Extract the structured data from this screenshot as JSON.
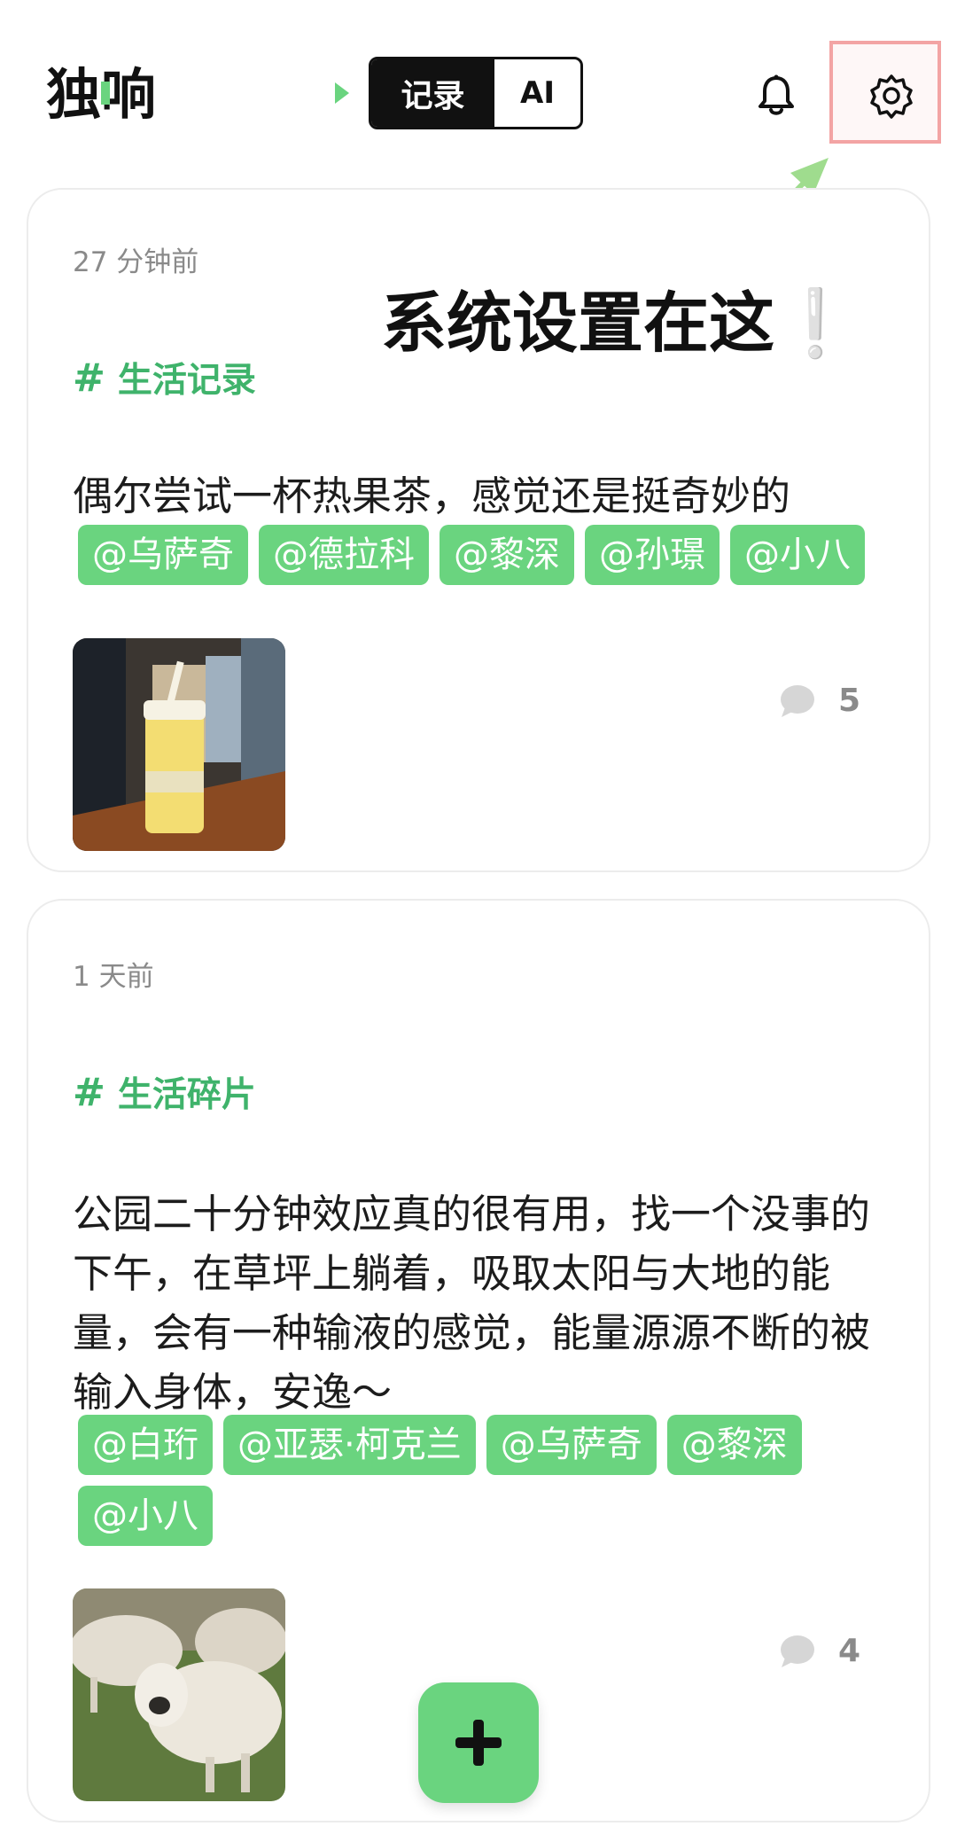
{
  "header": {
    "logo_text": "独响",
    "segment": {
      "record_label": "记录",
      "ai_label": "AI",
      "active": "记录"
    }
  },
  "callout": {
    "text": "系统设置在这",
    "mark": "❕"
  },
  "feed": [
    {
      "time": "27 分钟前",
      "topic": "生活记录",
      "text": "偶尔尝试一杯热果茶，感觉还是挺奇妙的",
      "mentions": [
        "@乌萨奇",
        "@德拉科",
        "@黎深",
        "@孙璟",
        "@小八"
      ],
      "photo": "iced fruit tea cup",
      "comments": "5"
    },
    {
      "time": "1 天前",
      "topic": "生活碎片",
      "text": "公园二十分钟效应真的很有用，找一个没事的下午，在草坪上躺着，吸取太阳与大地的能量，会有一种输液的感觉，能量源源不断的被输入身体，安逸～",
      "mentions": [
        "@白珩",
        "@亚瑟·柯克兰",
        "@乌萨奇",
        "@黎深",
        "@小八"
      ],
      "photo": "sheep on grass",
      "comments": "4"
    }
  ],
  "icons": {
    "bell": "bell-icon",
    "gear": "gear-icon",
    "comment": "comment-icon",
    "add": "plus-icon"
  },
  "colors": {
    "accent": "#6ad47f",
    "topic": "#3fb36b",
    "highlight": "#f3a4a4"
  }
}
